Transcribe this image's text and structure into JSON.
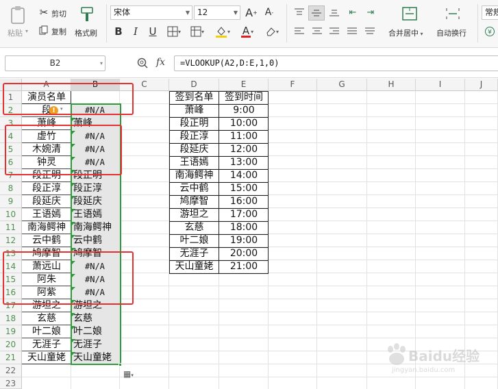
{
  "ribbon": {
    "paste_label": "粘贴",
    "cut_label": "剪切",
    "copy_label": "复制",
    "format_painter_label": "格式刷",
    "font_name": "宋体",
    "font_size": "12",
    "merge_center_label": "合并居中",
    "wrap_text_label": "自动换行",
    "number_format": "常规"
  },
  "formula_bar": {
    "cell_ref": "B2",
    "fx_label": "fx",
    "formula": "=VLOOKUP(A2,D:E,1,0)"
  },
  "columns": [
    "A",
    "B",
    "C",
    "D",
    "E",
    "F",
    "G",
    "H",
    "I",
    "J"
  ],
  "rows": [
    "1",
    "2",
    "3",
    "4",
    "5",
    "6",
    "7",
    "8",
    "9",
    "10",
    "11",
    "12",
    "13",
    "14",
    "15",
    "16",
    "17",
    "18",
    "19",
    "20",
    "21",
    "22",
    "23"
  ],
  "col_a": [
    "演员名单",
    "段",
    "萧峰",
    "虚竹",
    "木婉清",
    "钟灵",
    "段正明",
    "段正淳",
    "段延庆",
    "王语嫣",
    "南海鳄神",
    "云中鹤",
    "鸠摩智",
    "萧远山",
    "阿朱",
    "阿紫",
    "游坦之",
    "玄慈",
    "叶二娘",
    "无涯子",
    "天山童姥"
  ],
  "col_b": [
    "",
    "#N/A",
    "萧峰",
    "#N/A",
    "#N/A",
    "#N/A",
    "段正明",
    "段正淳",
    "段延庆",
    "王语嫣",
    "南海鳄神",
    "云中鹤",
    "鸠摩智",
    "#N/A",
    "#N/A",
    "#N/A",
    "游坦之",
    "玄慈",
    "叶二娘",
    "无涯子",
    "天山童姥"
  ],
  "col_d": [
    "签到名单",
    "萧峰",
    "段正明",
    "段正淳",
    "段延庆",
    "王语嫣",
    "南海鳄神",
    "云中鹤",
    "鸠摩智",
    "游坦之",
    "玄慈",
    "叶二娘",
    "无涯子",
    "天山童姥"
  ],
  "col_e": [
    "签到时间",
    "9:00",
    "10:00",
    "11:00",
    "12:00",
    "13:00",
    "14:00",
    "15:00",
    "16:00",
    "17:00",
    "18:00",
    "19:00",
    "20:00",
    "21:00"
  ],
  "watermark": {
    "logo": "Baidu经验",
    "url": "jingyan.baidu.com"
  },
  "colors": {
    "selection_border": "#2e9b3a",
    "annotation_red": "#e53030",
    "warning_orange": "#f0a020"
  }
}
